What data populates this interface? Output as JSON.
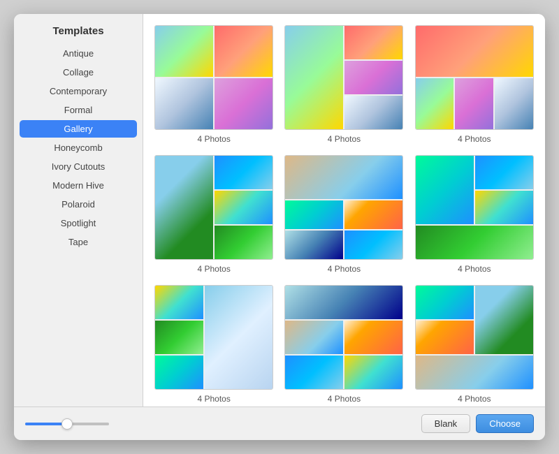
{
  "window": {
    "title": "Templates"
  },
  "sidebar": {
    "title": "Templates",
    "items": [
      {
        "id": "antique",
        "label": "Antique",
        "active": false
      },
      {
        "id": "collage",
        "label": "Collage",
        "active": false
      },
      {
        "id": "contemporary",
        "label": "Contemporary",
        "active": false
      },
      {
        "id": "formal",
        "label": "Formal",
        "active": false
      },
      {
        "id": "gallery",
        "label": "Gallery",
        "active": true
      },
      {
        "id": "honeycomb",
        "label": "Honeycomb",
        "active": false
      },
      {
        "id": "ivory-cutouts",
        "label": "Ivory Cutouts",
        "active": false
      },
      {
        "id": "modern-hive",
        "label": "Modern Hive",
        "active": false
      },
      {
        "id": "polaroid",
        "label": "Polaroid",
        "active": false
      },
      {
        "id": "spotlight",
        "label": "Spotlight",
        "active": false
      },
      {
        "id": "tape",
        "label": "Tape",
        "active": false
      }
    ]
  },
  "templates": {
    "items": [
      {
        "id": "t1",
        "label": "4 Photos"
      },
      {
        "id": "t2",
        "label": "4 Photos"
      },
      {
        "id": "t3",
        "label": "4 Photos"
      },
      {
        "id": "t4",
        "label": "4 Photos"
      },
      {
        "id": "t5",
        "label": "4 Photos"
      },
      {
        "id": "t6",
        "label": "4 Photos"
      },
      {
        "id": "t7",
        "label": "4 Photos"
      },
      {
        "id": "t8",
        "label": "4 Photos"
      },
      {
        "id": "t9",
        "label": "4 Photos"
      }
    ]
  },
  "footer": {
    "blank_label": "Blank",
    "choose_label": "Choose",
    "slider_value": 50
  }
}
